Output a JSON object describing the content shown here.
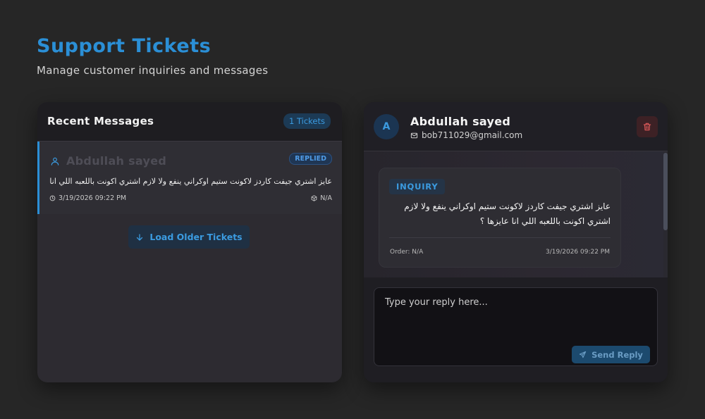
{
  "page": {
    "title": "Support Tickets",
    "subtitle": "Manage customer inquiries and messages"
  },
  "colors": {
    "accent": "#2b8fd6",
    "background": "#262626",
    "danger": "#e05a5a"
  },
  "left_panel": {
    "title": "Recent Messages",
    "ticket_count": "1 Tickets",
    "tickets": [
      {
        "name": "Abdullah sayed",
        "status": "REPLIED",
        "preview": "عايز اشتري جيفت كاردز لاكونت ستيم اوكراني ينفع ولا لازم اشتري اكونت باللعبه اللي انا...",
        "date": "3/19/2026 09:22 PM",
        "order": "N/A",
        "icons": {
          "user": "user-icon",
          "clock": "clock-icon",
          "box": "box-icon"
        }
      }
    ],
    "load_older_label": "Load Older Tickets"
  },
  "right_panel": {
    "contact": {
      "avatar_letter": "A",
      "name": "Abdullah sayed",
      "email": "bob711029@gmail.com"
    },
    "message": {
      "type": "INQUIRY",
      "text": "عايز اشتري جيفت كاردز لاكونت ستيم اوكراني ينفع ولا لازم اشتري اكونت باللعبه اللي انا عايزها ؟",
      "order": "Order: N/A",
      "time": "3/19/2026 09:22 PM"
    },
    "reply": {
      "placeholder": "Type your reply here...",
      "value": "",
      "send_label": "Send Reply"
    }
  }
}
